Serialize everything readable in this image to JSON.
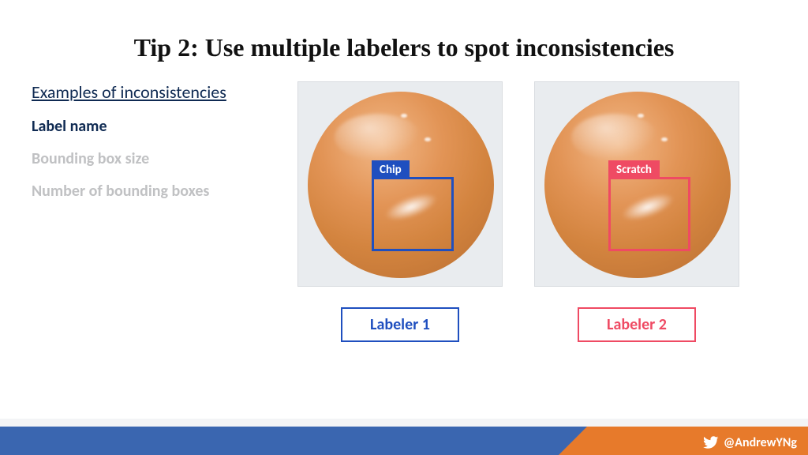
{
  "title": "Tip 2: Use multiple labelers to spot inconsistencies",
  "subtitle": "Examples of inconsistencies",
  "bullets": {
    "b1": "Label name",
    "b2": "Bounding box size",
    "b3": "Number of bounding boxes"
  },
  "panels": {
    "left": {
      "bbox_label": "Chip",
      "caption": "Labeler 1",
      "color": "#1f4fbf"
    },
    "right": {
      "bbox_label": "Scratch",
      "caption": "Labeler 2",
      "color": "#ef4a63"
    }
  },
  "footer": {
    "handle": "@AndrewYNg",
    "icon": "twitter-bird-icon"
  }
}
